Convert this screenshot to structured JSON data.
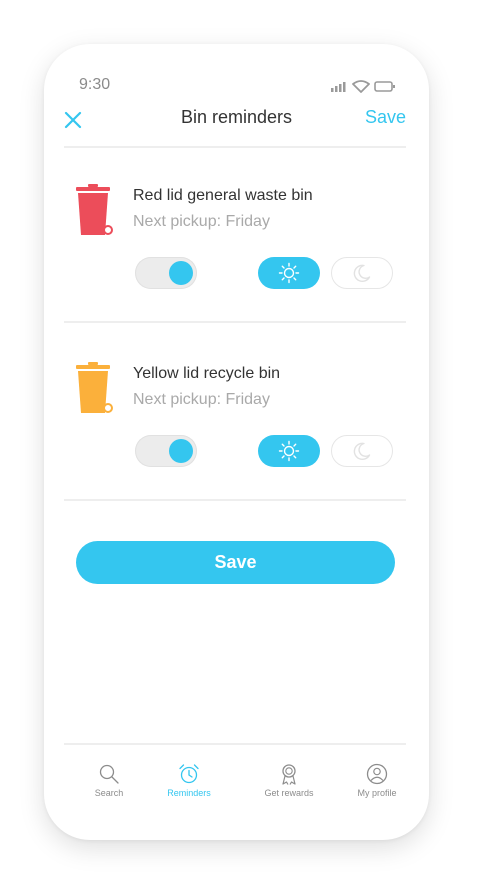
{
  "status_bar": {
    "time": "9:30"
  },
  "header": {
    "title": "Bin reminders",
    "save_label": "Save"
  },
  "bins": [
    {
      "name": "Red lid general waste bin",
      "pickup": "Next pickup: Friday",
      "lid_color": "#ec4d5a",
      "reminder_on": true,
      "time_of_day": "day"
    },
    {
      "name": "Yellow lid recycle bin",
      "pickup": "Next pickup: Friday",
      "lid_color": "#fbb03b",
      "reminder_on": true,
      "time_of_day": "day"
    }
  ],
  "main": {
    "save_label": "Save"
  },
  "bottom_nav": {
    "items": [
      {
        "label": "Search",
        "icon": "search-icon"
      },
      {
        "label": "Reminders",
        "icon": "alarm-clock-icon",
        "active": true
      },
      {
        "label": "Get rewards",
        "icon": "award-ribbon-icon"
      },
      {
        "label": "My profile",
        "icon": "user-profile-icon"
      }
    ]
  },
  "colors": {
    "accent": "#34c6ef",
    "red_bin": "#ec4d5a",
    "yellow_bin": "#fbb03b",
    "text": "#333333",
    "muted": "#a9a9a9"
  }
}
